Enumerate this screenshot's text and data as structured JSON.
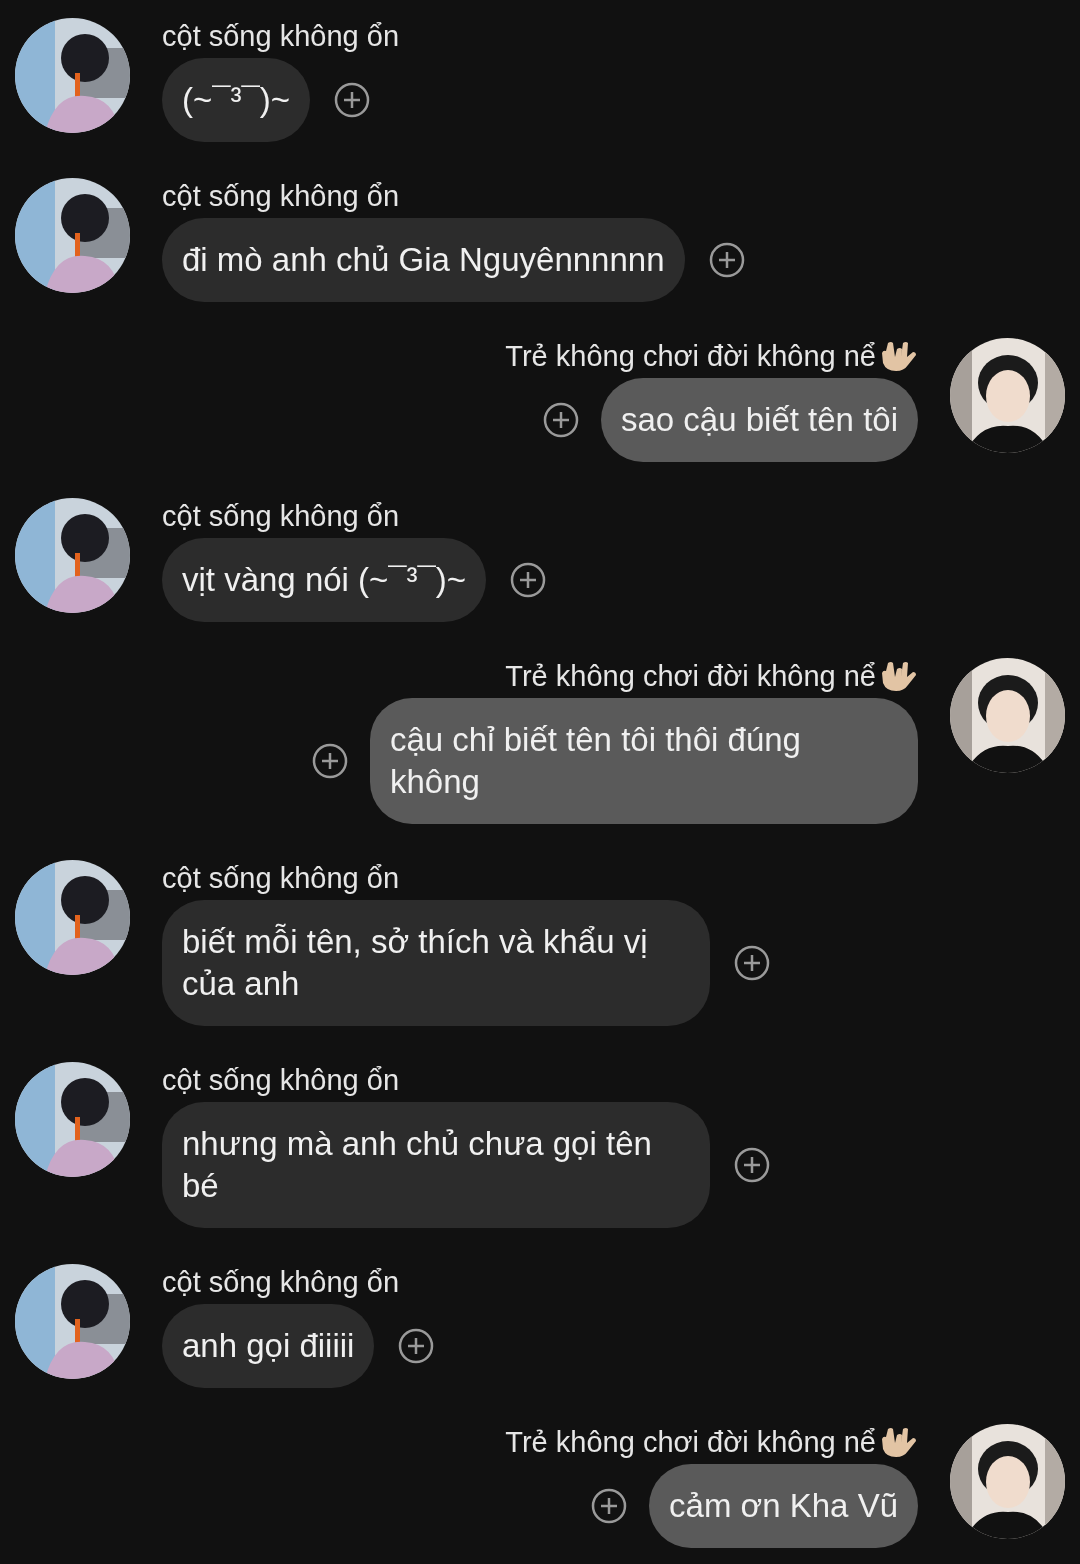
{
  "messages": [
    {
      "kind": "incoming",
      "sender": "cột sống không ổn",
      "text": "(~¯³¯)~"
    },
    {
      "kind": "incoming",
      "sender": "cột sống không ổn",
      "text": "đi mò anh chủ Gia Nguyênnnnnn"
    },
    {
      "kind": "outgoing",
      "sender": "Trẻ không chơi đời không nể",
      "text": "sao cậu biết tên tôi"
    },
    {
      "kind": "incoming",
      "sender": "cột sống không ổn",
      "text": "vịt vàng nói (~¯³¯)~"
    },
    {
      "kind": "outgoing",
      "sender": "Trẻ không chơi đời không nể",
      "text": "cậu chỉ biết tên tôi thôi đúng không"
    },
    {
      "kind": "incoming",
      "sender": "cột sống không ổn",
      "text": "biết mỗi tên, sở thích và khẩu vị của anh"
    },
    {
      "kind": "incoming",
      "sender": "cột sống không ổn",
      "text": "nhưng mà anh chủ chưa gọi tên bé"
    },
    {
      "kind": "incoming",
      "sender": "cột sống không ổn",
      "text": "anh gọi điiiii"
    },
    {
      "kind": "outgoing",
      "sender": "Trẻ không chơi đời không nể",
      "text": "cảm ơn Kha Vũ"
    }
  ]
}
